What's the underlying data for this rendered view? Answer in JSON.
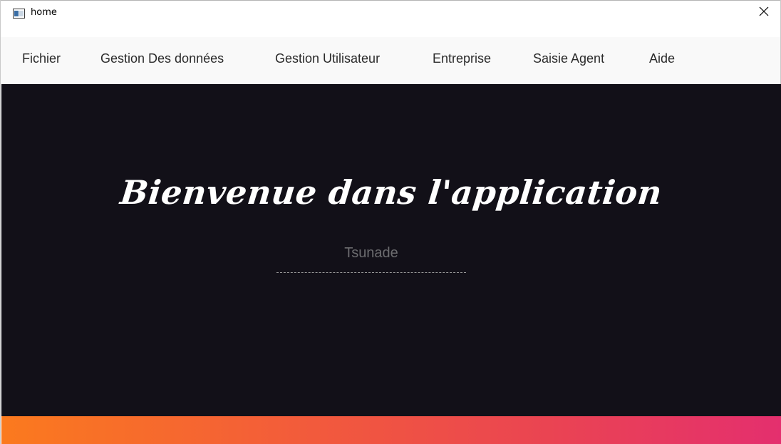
{
  "window": {
    "title": "home",
    "icon": "window-app-icon",
    "close_icon": "close-icon"
  },
  "menu": {
    "items": [
      {
        "label": "Fichier"
      },
      {
        "label": "Gestion Des données"
      },
      {
        "label": "Gestion Utilisateur"
      },
      {
        "label": "Entreprise"
      },
      {
        "label": "Saisie Agent"
      },
      {
        "label": "Aide"
      }
    ]
  },
  "main": {
    "welcome_text": "Bienvenue dans l'application",
    "username": "Tsunade"
  },
  "colors": {
    "background": "#121018",
    "menubar": "#f9f9f9",
    "gradient_start": "#fb7a1e",
    "gradient_end": "#e42f6e"
  }
}
